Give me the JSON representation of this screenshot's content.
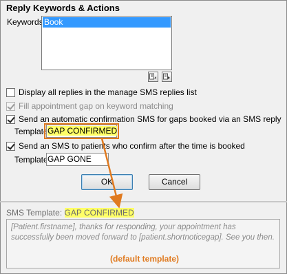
{
  "dialog": {
    "title": "Reply Keywords & Actions",
    "keywords_label": "Keywords",
    "keywords": [
      "Book"
    ],
    "options": [
      {
        "label": "Display all replies in the manage SMS replies list",
        "checked": false,
        "disabled": false
      },
      {
        "label": "Fill appointment gap on keyword matching",
        "checked": true,
        "disabled": true
      },
      {
        "label": "Send an automatic confirmation SMS for gaps booked via an SMS reply",
        "checked": true,
        "disabled": false
      },
      {
        "label": "Send an SMS to patients who confirm after the time is booked",
        "checked": true,
        "disabled": false
      }
    ],
    "template1": {
      "label": "Template",
      "value": "GAP CONFIRMED",
      "highlighted": true
    },
    "template2": {
      "label": "Template",
      "value": "GAP GONE"
    },
    "ok_label": "OK",
    "cancel_label": "Cancel"
  },
  "sms_preview": {
    "label": "SMS Template:",
    "template_name": "GAP CONFIRMED",
    "body": "[Patient.firstname], thanks for responding, your appointment has successfully been moved forward to [patient.shortnoticegap]. See you then.",
    "note": "(default template)"
  },
  "colors": {
    "highlight": "#ffff66",
    "callout": "#e07a1f",
    "selection": "#3399ff"
  },
  "icons": [
    "list-import-icon",
    "list-export-icon"
  ]
}
